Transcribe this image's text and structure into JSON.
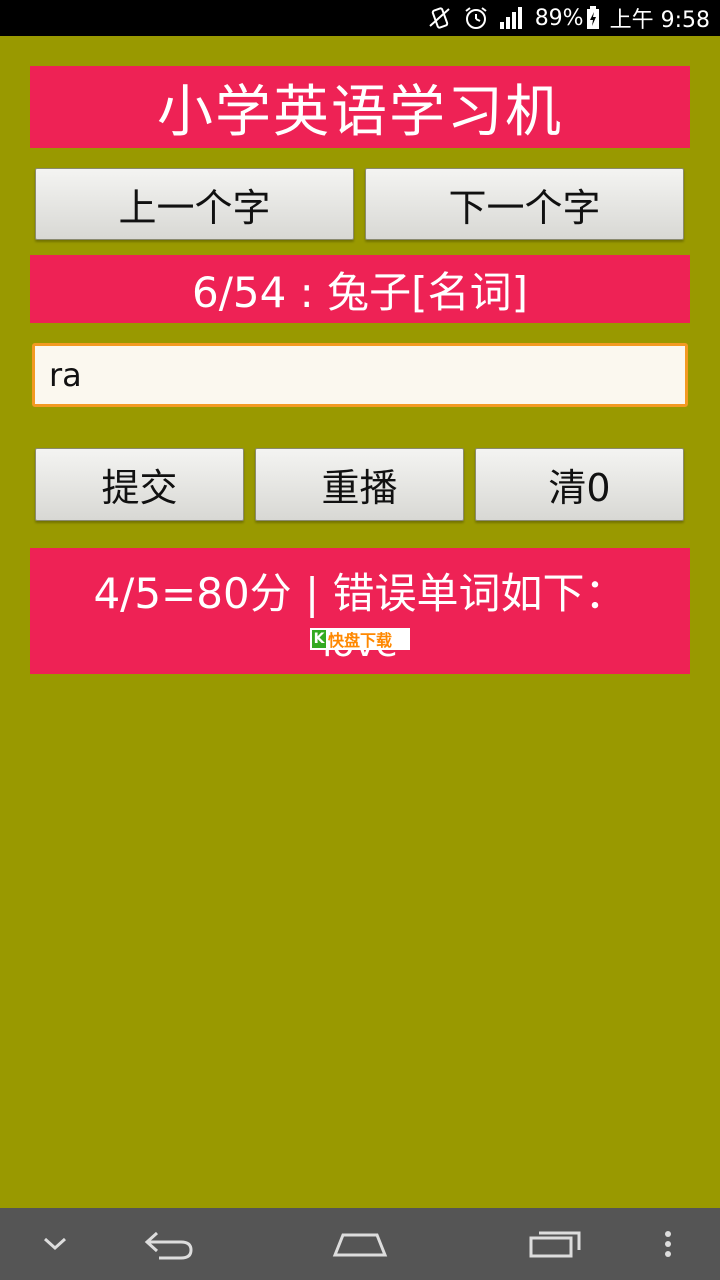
{
  "status_bar": {
    "battery_percent": "89%",
    "time": "上午 9:58"
  },
  "app": {
    "title": "小学英语学习机",
    "prev_button": "上一个字",
    "next_button": "下一个字",
    "word_info": "6/54 : 兔子[名词]",
    "answer_input": {
      "value": "ra"
    },
    "submit_button": "提交",
    "replay_button": "重播",
    "clear_button": "清0",
    "result_summary": "4/5=80分 | 错误单词如下：",
    "wrong_words": "love",
    "watermark_text": "快盘下载"
  },
  "colors": {
    "app_background": "#999900",
    "banner": "#ee2255",
    "input_border": "#f39a22",
    "nav_bar": "#555555"
  },
  "icons": {
    "status": [
      "vibrate-icon",
      "alarm-icon",
      "signal-icon",
      "battery-charging-icon"
    ],
    "nav": [
      "hide-keyboard-icon",
      "back-icon",
      "home-icon",
      "recent-apps-icon",
      "menu-icon"
    ]
  }
}
